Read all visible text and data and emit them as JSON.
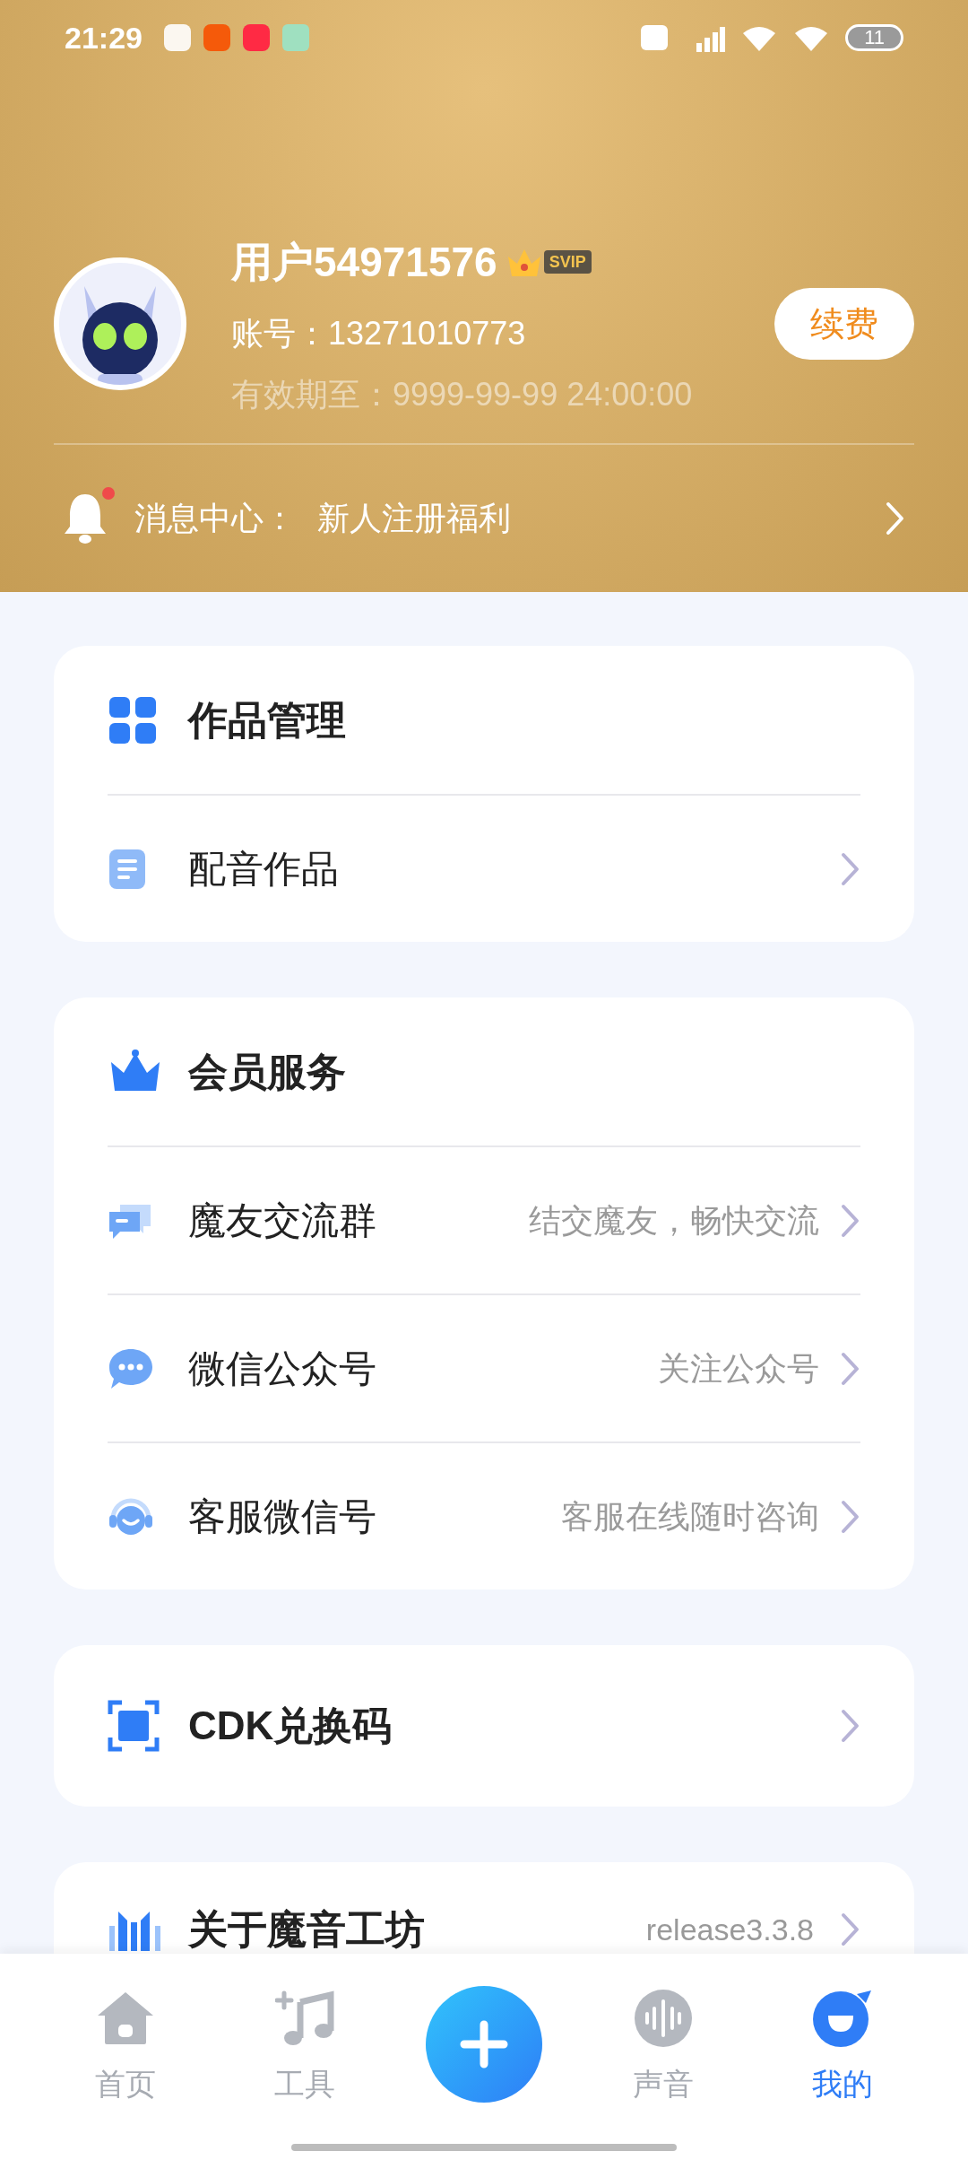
{
  "status_bar": {
    "time": "21:29",
    "battery": "11"
  },
  "profile": {
    "username": "用户54971576",
    "badge": "SVIP",
    "account": "账号：13271010773",
    "expiry": "有效期至：9999-99-99 24:00:00",
    "renew_button": "续费"
  },
  "messages": {
    "label": "消息中心：",
    "text": "新人注册福利",
    "unread": true
  },
  "sections": [
    {
      "title": "作品管理",
      "rows": [
        {
          "label": "配音作品"
        }
      ]
    },
    {
      "title": "会员服务",
      "rows": [
        {
          "label": "魔友交流群",
          "hint": "结交魔友，畅快交流"
        },
        {
          "label": "微信公众号",
          "hint": "关注公众号"
        },
        {
          "label": "客服微信号",
          "hint": "客服在线随时咨询"
        }
      ]
    },
    {
      "title": "CDK兑换码"
    },
    {
      "title": "关于魔音工坊",
      "hint": "release3.3.8"
    }
  ],
  "nav": [
    {
      "label": "首页",
      "selected": false
    },
    {
      "label": "工具",
      "selected": false
    },
    {
      "label": "声音",
      "selected": false
    },
    {
      "label": "我的",
      "selected": true
    }
  ]
}
